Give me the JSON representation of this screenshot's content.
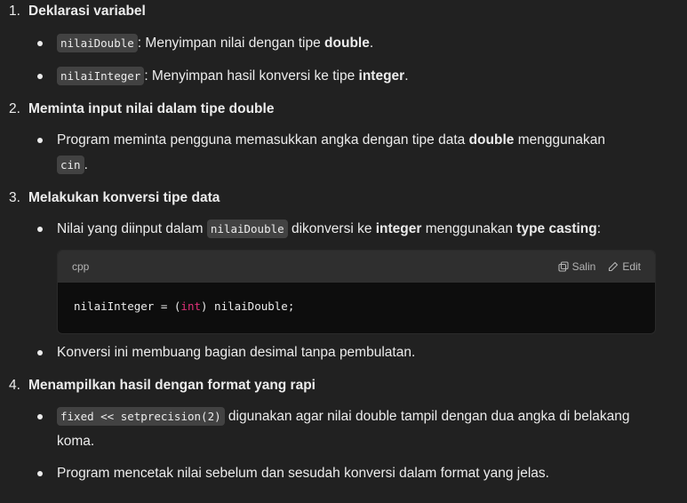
{
  "sections": [
    {
      "number": "1.",
      "heading": "Deklarasi variabel",
      "bullets": [
        {
          "code": "nilaiDouble",
          "text_a": ": Menyimpan nilai dengan tipe ",
          "bold": "double",
          "text_b": "."
        },
        {
          "code": "nilaiInteger",
          "text_a": ": Menyimpan hasil konversi ke tipe ",
          "bold": "integer",
          "text_b": "."
        }
      ]
    },
    {
      "number": "2.",
      "heading": "Meminta input nilai dalam tipe double",
      "bullets": [
        {
          "text_a": "Program meminta pengguna memasukkan angka dengan tipe data ",
          "bold": "double",
          "text_b": " menggunakan",
          "code": "cin",
          "text_c": "."
        }
      ]
    },
    {
      "number": "3.",
      "heading": "Melakukan konversi tipe data",
      "bullets": [
        {
          "text_a": "Nilai yang diinput dalam ",
          "code": "nilaiDouble",
          "text_b": " dikonversi ke ",
          "bold": "integer",
          "text_c": " menggunakan ",
          "bold2": "type casting",
          "text_d": ":"
        },
        {
          "text_a": "Konversi ini membuang bagian desimal tanpa pembulatan."
        }
      ]
    },
    {
      "number": "4.",
      "heading": "Menampilkan hasil dengan format yang rapi",
      "bullets": [
        {
          "code": "fixed << setprecision(2)",
          "text_a": " digunakan agar nilai double tampil dengan dua angka di belakang koma."
        },
        {
          "text_a": "Program mencetak nilai sebelum dan sesudah konversi dalam format yang jelas."
        }
      ]
    }
  ],
  "code_block": {
    "language": "cpp",
    "copy_label": "Salin",
    "edit_label": "Edit",
    "code_pre": "nilaiInteger = (",
    "code_kw": "int",
    "code_post": ") nilaiDouble;"
  },
  "colors": {
    "background": "#212121",
    "keyword": "#df3079",
    "inline_code_bg": "#424242"
  }
}
